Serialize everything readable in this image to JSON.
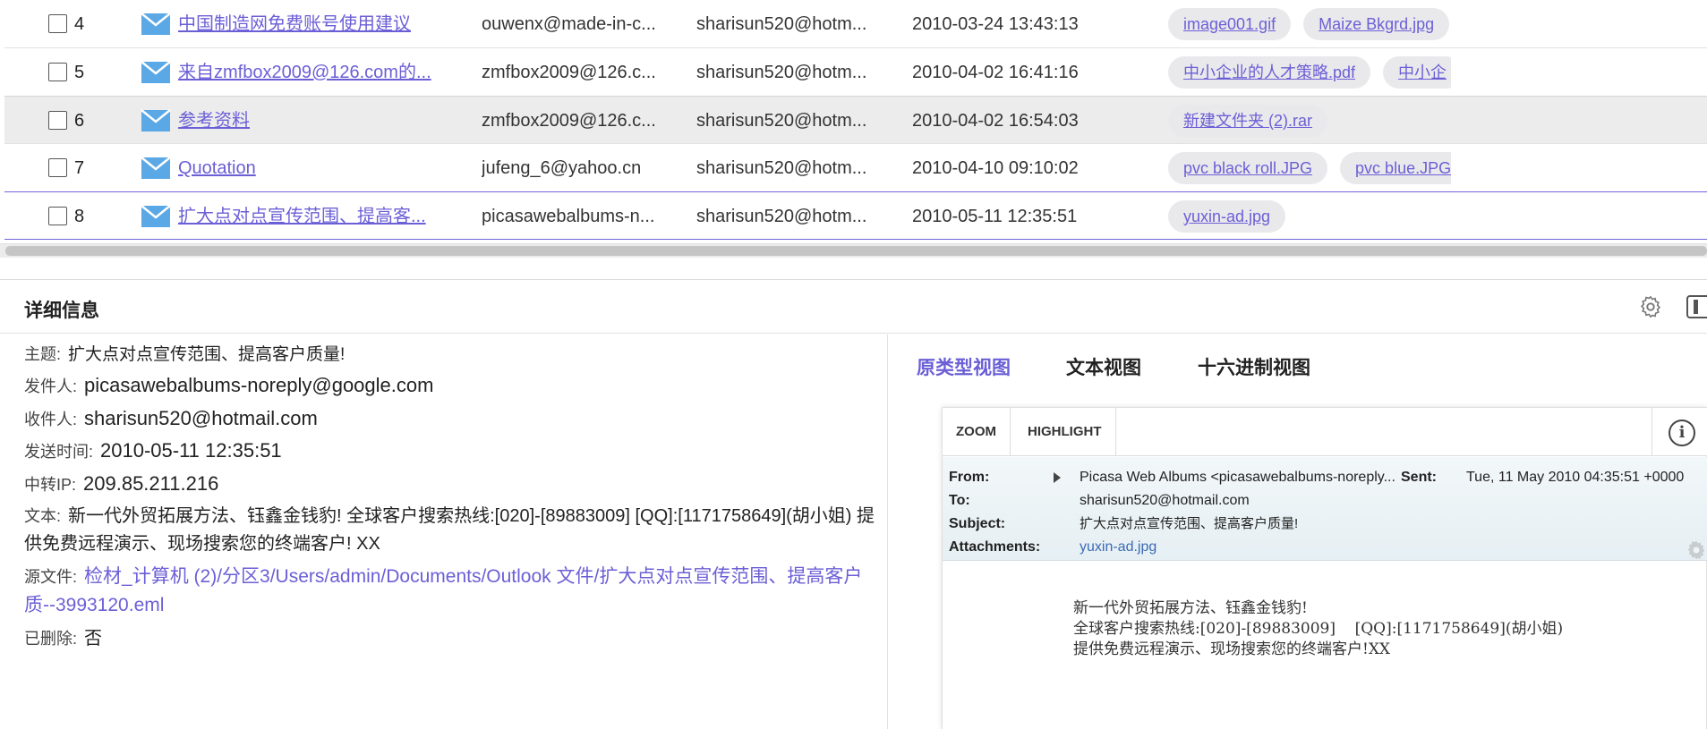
{
  "emails": [
    {
      "num": "4",
      "subject": "中国制造网免费账号使用建议",
      "from": "ouwenx@made-in-c...",
      "to": "sharisun520@hotm...",
      "date": "2010-03-24 13:43:13",
      "attachments": [
        "image001.gif",
        "Maize Bkgrd.jpg"
      ]
    },
    {
      "num": "5",
      "subject": "来自zmfbox2009@126.com的...",
      "from": "zmfbox2009@126.c...",
      "to": "sharisun520@hotm...",
      "date": "2010-04-02 16:41:16",
      "attachments": [
        "中小企业的人才策略.pdf",
        "中小企"
      ]
    },
    {
      "num": "6",
      "subject": "参考资料",
      "from": "zmfbox2009@126.c...",
      "to": "sharisun520@hotm...",
      "date": "2010-04-02 16:54:03",
      "attachments": [
        "新建文件夹 (2).rar"
      ]
    },
    {
      "num": "7",
      "subject": "Quotation",
      "from": "jufeng_6@yahoo.cn",
      "to": "sharisun520@hotm...",
      "date": "2010-04-10 09:10:02",
      "attachments": [
        "pvc black roll.JPG",
        "pvc blue.JPG"
      ]
    },
    {
      "num": "8",
      "subject": "扩大点对点宣传范围、提高客...",
      "from": "picasawebalbums-n...",
      "to": "sharisun520@hotm...",
      "date": "2010-05-11 12:35:51",
      "attachments": [
        "yuxin-ad.jpg"
      ]
    }
  ],
  "details": {
    "title": "详细信息",
    "fields": {
      "subject_label": "主题:",
      "subject": "扩大点对点宣传范围、提高客户质量!",
      "sender_label": "发件人:",
      "sender": "picasawebalbums-noreply@google.com",
      "recipient_label": "收件人:",
      "recipient": "sharisun520@hotmail.com",
      "sent_label": "发送时间:",
      "sent": "2010-05-11 12:35:51",
      "relay_label": "中转IP:",
      "relay": "209.85.211.216",
      "text_label": "文本:",
      "text": "新一代外贸拓展方法、钰鑫金钱豹! 全球客户搜索热线:[020]-[89883009] [QQ]:[1171758649](胡小姐) 提供免费远程演示、现场搜索您的终端客户! XX",
      "source_label": "源文件:",
      "source": "检材_计算机 (2)/分区3/Users/admin/Documents/Outlook 文件/扩大点对点宣传范围、提高客户质--3993120.eml",
      "deleted_label": "已删除:",
      "deleted": "否"
    },
    "tabs": [
      "原类型视图",
      "文本视图",
      "十六进制视图"
    ],
    "viewer": {
      "zoom": "ZOOM",
      "highlight": "HIGHLIGHT",
      "info_icon": "i",
      "from_label": "From:",
      "from": "Picasa Web Albums <picasawebalbums-noreply...",
      "sent_label": "Sent:",
      "sent": "Tue, 11 May 2010 04:35:51 +0000",
      "to_label": "To:",
      "to": "sharisun520@hotmail.com",
      "subject_label": "Subject:",
      "subject": "扩大点对点宣传范围、提高客户质量!",
      "attachments_label": "Attachments:",
      "attachment": "yuxin-ad.jpg",
      "body": "新一代外贸拓展方法、钰鑫金钱豹!\n全球客户搜索热线:[020]-[89883009]    [QQ]:[1171758649](胡小姐)\n提供免费远程演示、现场搜索您的终端客户!XX"
    }
  },
  "colors": {
    "accent": "#6b5fd6",
    "link_blue": "#3a6bb5",
    "selected_row": "#ececec"
  }
}
